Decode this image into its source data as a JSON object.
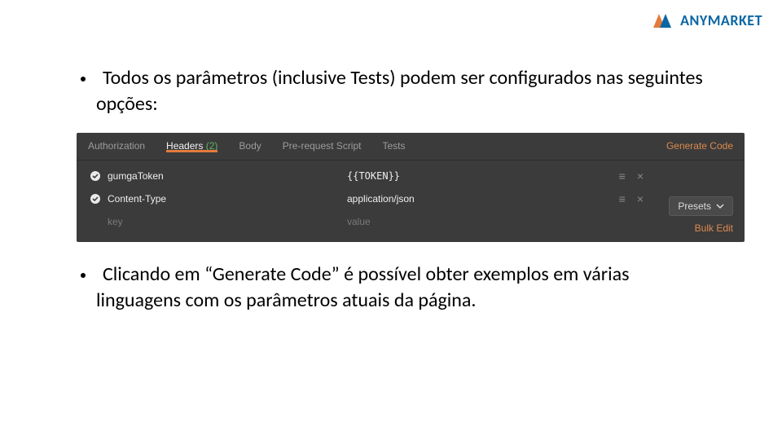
{
  "brand": {
    "mark_name": "anymarket-logo",
    "word_any": "ANY",
    "word_market": "MARKET"
  },
  "bullets": {
    "b1": "Todos os parâmetros (inclusive Tests) podem ser configurados nas seguintes opções:",
    "b2": "Clicando em “Generate Code” é possível obter exemplos em várias linguagens com os parâmetros atuais da página."
  },
  "postman": {
    "tabs": {
      "authorization": "Authorization",
      "headers_label": "Headers",
      "headers_count": "(2)",
      "body": "Body",
      "prerequest": "Pre-request Script",
      "tests": "Tests"
    },
    "generate_code": "Generate Code",
    "presets": "Presets",
    "rows": [
      {
        "key": "gumgaToken",
        "value": "{{TOKEN}}"
      },
      {
        "key": "Content-Type",
        "value": "application/json"
      }
    ],
    "placeholder": {
      "key": "key",
      "value": "value"
    },
    "bulk_edit": "Bulk Edit",
    "icons": {
      "drag": "≡",
      "close": "×"
    }
  }
}
